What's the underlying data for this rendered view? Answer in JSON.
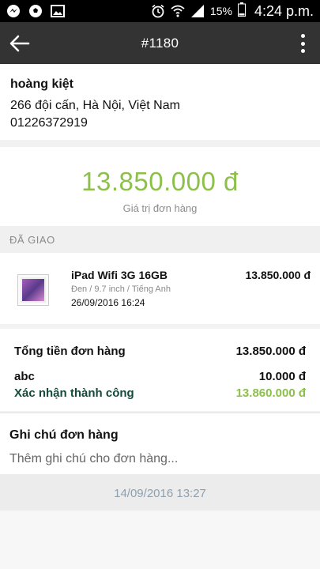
{
  "status_bar": {
    "time": "4:24 p.m.",
    "battery": "15%",
    "icons": [
      "messenger-icon",
      "soccer-ball-icon",
      "gallery-icon",
      "alarm-icon",
      "wifi-icon",
      "signal-icon",
      "battery-icon"
    ]
  },
  "app_bar": {
    "title": "#1180",
    "back_icon": "arrow-left-icon",
    "menu_icon": "more-vertical-icon"
  },
  "customer": {
    "name": "hoàng kiệt",
    "address": "266 đội cấn, Hà Nội, Việt Nam",
    "phone": "01226372919"
  },
  "order_total": {
    "amount": "13.850.000 đ",
    "label": "Giá trị đơn hàng",
    "color": "#8cc04a"
  },
  "status_section": {
    "label": "ĐÃ GIAO"
  },
  "product": {
    "name": "iPad Wifi 3G 16GB",
    "variant": "Đen / 9.7 inch / Tiếng Anh",
    "date": "26/09/2016 16:24",
    "price": "13.850.000 đ"
  },
  "summary": {
    "subtotal_label": "Tổng tiền đơn hàng",
    "subtotal_value": "13.850.000 đ",
    "extra_label": "abc",
    "extra_value": "10.000 đ",
    "confirmed_label": "Xác nhận thành công",
    "confirmed_value": "13.860.000 đ"
  },
  "note": {
    "title": "Ghi chú đơn hàng",
    "placeholder": "Thêm ghi chú cho đơn hàng..."
  },
  "footer": {
    "date": "14/09/2016 13:27"
  }
}
